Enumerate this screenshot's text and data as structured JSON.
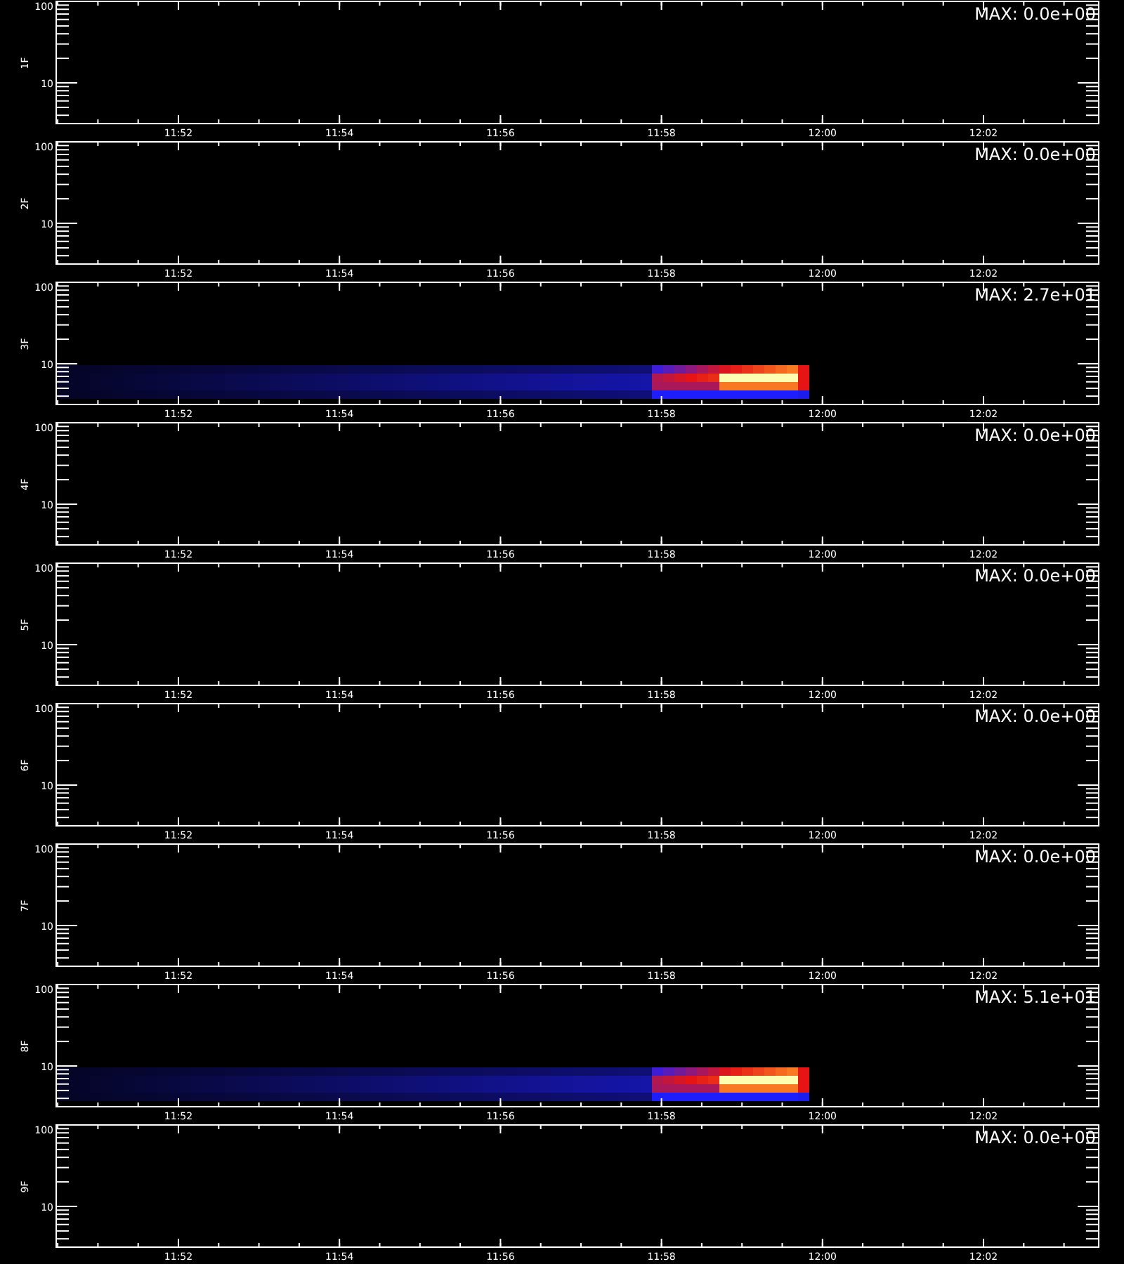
{
  "panels": [
    {
      "label": "1F",
      "max": "MAX: 0.0e+00",
      "kind": "empty",
      "y_ticks": [
        "100",
        "10"
      ],
      "x_ticks": [
        "11:52",
        "11:54",
        "11:56",
        "11:58",
        "12:00",
        "12:02"
      ]
    },
    {
      "label": "2F",
      "max": "MAX: 0.0e+00",
      "kind": "empty",
      "y_ticks": [
        "100",
        "10"
      ],
      "x_ticks": [
        "11:52",
        "11:54",
        "11:56",
        "11:58",
        "12:00",
        "12:02"
      ]
    },
    {
      "label": "3F",
      "max": "MAX: 2.7e+01",
      "kind": "signal",
      "y_ticks": [
        "100",
        "10"
      ],
      "x_ticks": [
        "11:52",
        "11:54",
        "11:56",
        "11:58",
        "12:00",
        "12:02"
      ]
    },
    {
      "label": "4F",
      "max": "MAX: 0.0e+00",
      "kind": "empty",
      "y_ticks": [
        "100",
        "10"
      ],
      "x_ticks": [
        "11:52",
        "11:54",
        "11:56",
        "11:58",
        "12:00",
        "12:02"
      ]
    },
    {
      "label": "5F",
      "max": "MAX: 0.0e+00",
      "kind": "empty",
      "y_ticks": [
        "100",
        "10"
      ],
      "x_ticks": [
        "11:52",
        "11:54",
        "11:56",
        "11:58",
        "12:00",
        "12:02"
      ]
    },
    {
      "label": "6F",
      "max": "MAX: 0.0e+00",
      "kind": "empty",
      "y_ticks": [
        "100",
        "10"
      ],
      "x_ticks": [
        "11:52",
        "11:54",
        "11:56",
        "11:58",
        "12:00",
        "12:02"
      ]
    },
    {
      "label": "7F",
      "max": "MAX: 0.0e+00",
      "kind": "empty",
      "y_ticks": [
        "100",
        "10"
      ],
      "x_ticks": [
        "11:52",
        "11:54",
        "11:56",
        "11:58",
        "12:00",
        "12:02"
      ]
    },
    {
      "label": "8F",
      "max": "MAX: 5.1e+01",
      "kind": "signal",
      "y_ticks": [
        "100",
        "10"
      ],
      "x_ticks": [
        "11:52",
        "11:54",
        "11:56",
        "11:58",
        "12:00",
        "12:02"
      ]
    },
    {
      "label": "9F",
      "max": "MAX: 0.0e+00",
      "kind": "empty",
      "y_ticks": [
        "100",
        "10"
      ],
      "x_ticks": [
        "11:52",
        "11:54",
        "11:56",
        "11:58",
        "12:00",
        "12:02"
      ]
    }
  ]
}
